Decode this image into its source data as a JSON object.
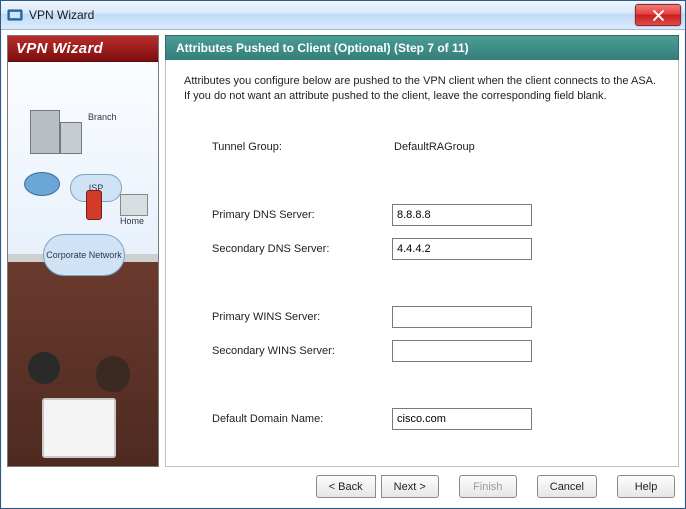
{
  "window": {
    "title": "VPN Wizard"
  },
  "sidebar": {
    "title": "VPN Wizard",
    "labels": {
      "branch": "Branch",
      "isp": "ISP",
      "home": "Home",
      "corporate": "Corporate Network"
    }
  },
  "step": {
    "header": "Attributes Pushed to Client (Optional)  (Step 7 of 11)",
    "instructions": "Attributes you configure below are pushed to the VPN client when the client connects to the ASA. If you do not want an attribute pushed to the client, leave the corresponding field blank."
  },
  "form": {
    "tunnel_group_label": "Tunnel Group:",
    "tunnel_group_value": "DefaultRAGroup",
    "primary_dns_label": "Primary DNS Server:",
    "primary_dns_value": "8.8.8.8",
    "secondary_dns_label": "Secondary DNS Server:",
    "secondary_dns_value": "4.4.4.2",
    "primary_wins_label": "Primary WINS Server:",
    "primary_wins_value": "",
    "secondary_wins_label": "Secondary WINS Server:",
    "secondary_wins_value": "",
    "default_domain_label": "Default Domain Name:",
    "default_domain_value": "cisco.com"
  },
  "buttons": {
    "back": "< Back",
    "next": "Next >",
    "finish": "Finish",
    "cancel": "Cancel",
    "help": "Help"
  }
}
